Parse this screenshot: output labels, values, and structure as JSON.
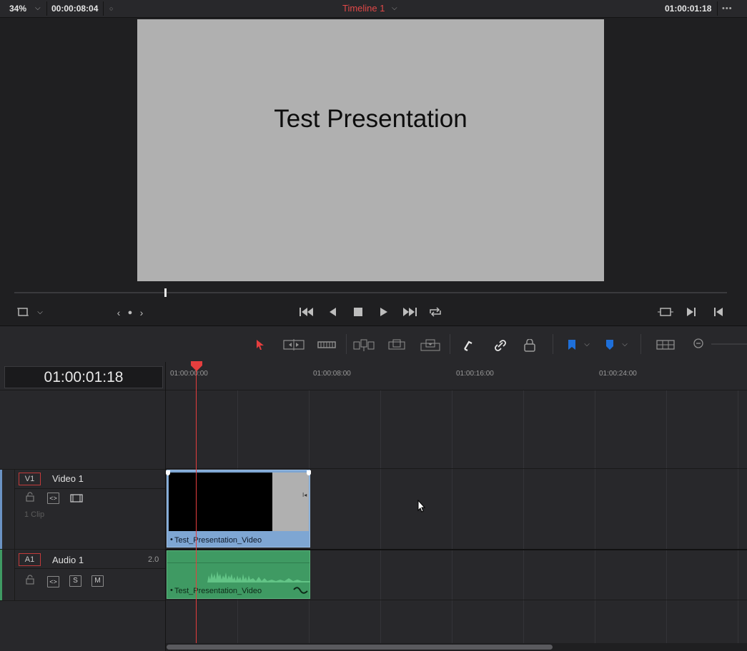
{
  "topbar": {
    "zoom": "34%",
    "duration": "00:00:08:04",
    "timeline_name": "Timeline 1",
    "current_timecode": "01:00:01:18",
    "more": "•••"
  },
  "viewer": {
    "frame_text": "Test Presentation"
  },
  "timeline": {
    "timecode": "01:00:01:18",
    "ruler": [
      "01:00:00:00",
      "01:00:08:00",
      "01:00:16:00",
      "01:00:24:00"
    ],
    "tracks": {
      "video": {
        "badge": "V1",
        "name": "Video 1",
        "clip_count": "1 Clip",
        "clip_name": "Test_Presentation_Video"
      },
      "audio": {
        "badge": "A1",
        "name": "Audio 1",
        "channels": "2.0",
        "solo": "S",
        "mute": "M",
        "clip_name": "Test_Presentation_Video"
      }
    }
  },
  "colors": {
    "accent_red": "#e53e3e",
    "video_clip": "#7ea6d3",
    "audio_clip": "#3f9a63",
    "flag_blue": "#1e6fd9"
  },
  "icons": [
    "dropdown-chevron-icon",
    "pin-icon",
    "crop-icon",
    "prev-clip-icon",
    "next-clip-icon",
    "jump-to-start-icon",
    "reverse-play-icon",
    "stop-icon",
    "play-icon",
    "jump-to-end-icon",
    "loop-icon",
    "match-frame-icon",
    "next-edit-icon",
    "prev-edit-icon",
    "selection-pointer-icon",
    "trim-tool-icon",
    "blade-tool-icon",
    "insert-clip-icon",
    "overwrite-clip-icon",
    "replace-clip-icon",
    "snapping-icon",
    "linked-selection-icon",
    "position-lock-icon",
    "flag-icon",
    "marker-icon",
    "timeline-view-icon",
    "zoom-out-icon",
    "lock-icon",
    "auto-select-icon",
    "track-monitor-icon"
  ]
}
